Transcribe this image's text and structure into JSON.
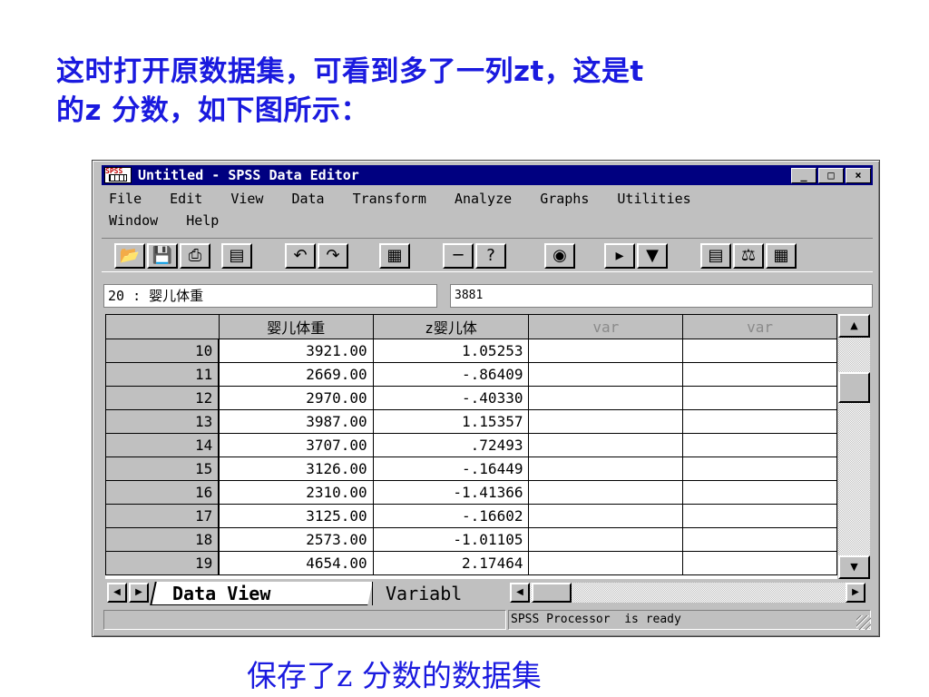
{
  "slide": {
    "heading_line1": "这时打开原数据集，可看到多了一列zt，这是t",
    "heading_line2": "的z 分数，如下图所示：",
    "caption": "保存了z 分数的数据集"
  },
  "window": {
    "app_icon_text": "SPSS",
    "title": "Untitled - SPSS Data Editor",
    "controls": {
      "minimize": "_",
      "maximize": "□",
      "close": "×"
    }
  },
  "menu": {
    "items": [
      "File",
      "Edit",
      "View",
      "Data",
      "Transform",
      "Analyze",
      "Graphs",
      "Utilities",
      "Window",
      "Help"
    ]
  },
  "toolbar": {
    "icons": [
      "open-icon",
      "save-icon",
      "print-icon",
      "dialog-recall-icon",
      "undo-icon",
      "redo-icon",
      "goto-chart-icon",
      "goto-case-icon",
      "variables-icon",
      "find-icon",
      "insert-case-icon",
      "insert-variable-icon",
      "split-file-icon",
      "weight-cases-icon",
      "select-cases-icon"
    ]
  },
  "cell_editor": {
    "reference": "20 : 婴儿体重",
    "value": "3881"
  },
  "grid": {
    "columns": [
      "婴儿体重",
      "z婴儿体",
      "var",
      "var"
    ],
    "rows": [
      {
        "n": "10",
        "weight": "3921.00",
        "z": "1.05253"
      },
      {
        "n": "11",
        "weight": "2669.00",
        "z": "-.86409"
      },
      {
        "n": "12",
        "weight": "2970.00",
        "z": "-.40330"
      },
      {
        "n": "13",
        "weight": "3987.00",
        "z": "1.15357"
      },
      {
        "n": "14",
        "weight": "3707.00",
        "z": ".72493"
      },
      {
        "n": "15",
        "weight": "3126.00",
        "z": "-.16449"
      },
      {
        "n": "16",
        "weight": "2310.00",
        "z": "-1.41366"
      },
      {
        "n": "17",
        "weight": "3125.00",
        "z": "-.16602"
      },
      {
        "n": "18",
        "weight": "2573.00",
        "z": "-1.01105"
      },
      {
        "n": "19",
        "weight": "4654.00",
        "z": "2.17464"
      }
    ]
  },
  "tabs": {
    "data_view": "Data View",
    "variable_view": "Variabl"
  },
  "status": {
    "text": "SPSS Processor  is ready"
  }
}
